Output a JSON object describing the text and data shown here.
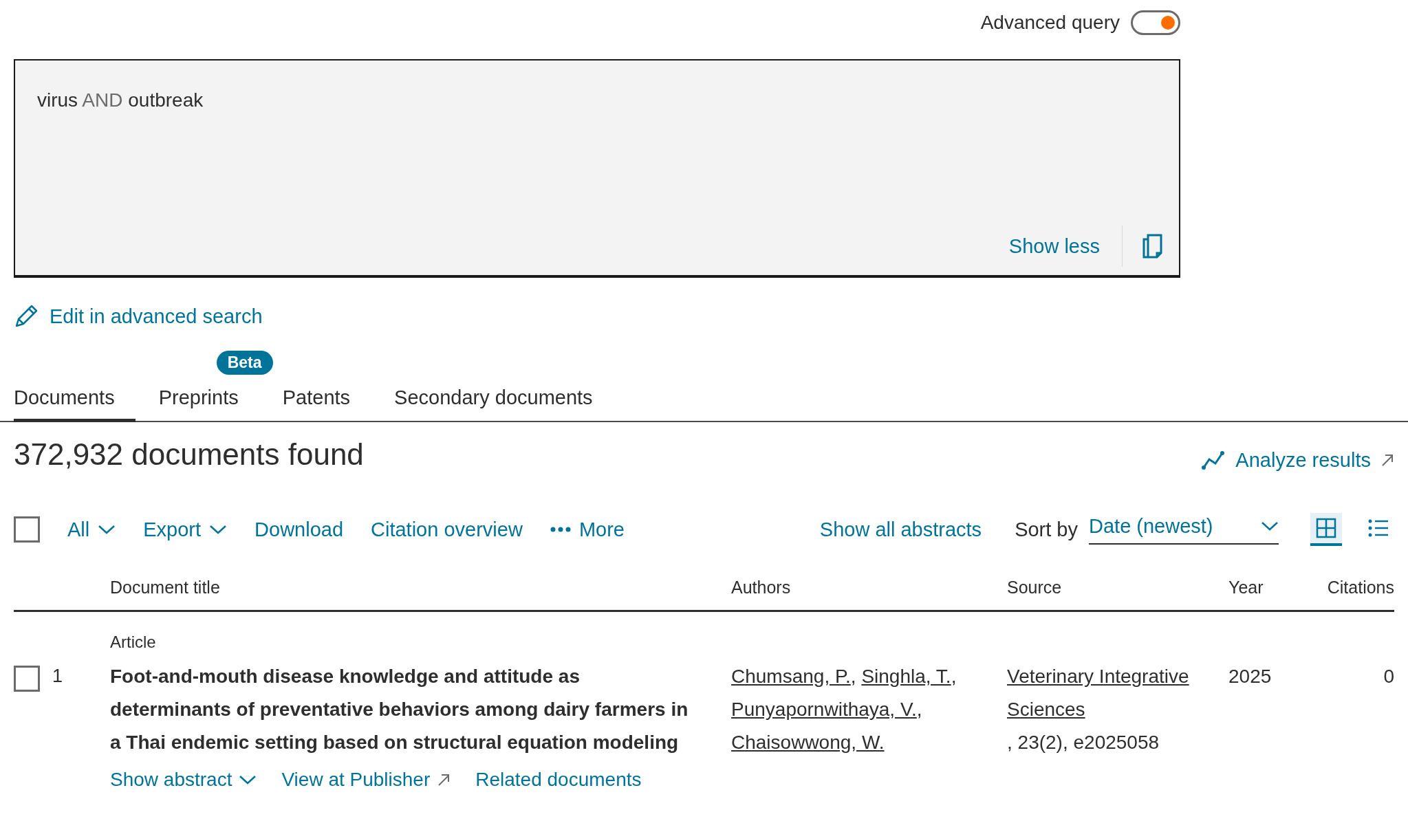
{
  "advanced_query": {
    "label": "Advanced query",
    "on": true
  },
  "query_box": {
    "parts": [
      {
        "kind": "term",
        "text": "virus"
      },
      {
        "kind": "operator",
        "text": "AND"
      },
      {
        "kind": "term",
        "text": "outbreak"
      }
    ],
    "toggle_label": "Show less"
  },
  "edit_link": "Edit in advanced search",
  "tabs": [
    {
      "label": "Documents",
      "selected": true
    },
    {
      "label": "Preprints",
      "selected": false,
      "badge": "Beta"
    },
    {
      "label": "Patents",
      "selected": false
    },
    {
      "label": "Secondary documents",
      "selected": false
    }
  ],
  "results_count": "372,932 documents found",
  "analyze_link": "Analyze results",
  "toolbar": {
    "select_all_checked": false,
    "actions": [
      {
        "label": "All",
        "kind": "dropdown"
      },
      {
        "label": "Export",
        "kind": "dropdown"
      },
      {
        "label": "Download",
        "kind": "link"
      },
      {
        "label": "Citation overview",
        "kind": "link"
      },
      {
        "label": "More",
        "kind": "more"
      }
    ],
    "show_all_abstracts": "Show all abstracts",
    "sort_label": "Sort by",
    "sort_value": "Date (newest)",
    "views": [
      {
        "kind": "grid",
        "selected": true
      },
      {
        "kind": "list",
        "selected": false
      }
    ]
  },
  "table": {
    "columns": [
      "Document title",
      "Authors",
      "Source",
      "Year",
      "Citations"
    ],
    "rows": [
      {
        "checked": false,
        "index": "1",
        "type": "Article",
        "title": "Foot-and-mouth disease knowledge and attitude as determinants of preventative behaviors among dairy farmers in a Thai endemic setting based on structural equation modeling",
        "author_separator": ",",
        "authors": [
          "Chumsang, P.",
          "Singhla, T.",
          "Punyapornwithaya, V.",
          "Chaisowwong, W."
        ],
        "source_name": "Veterinary Integrative Sciences",
        "source_details": ", 23(2), e2025058",
        "year": "2025",
        "citations": "0",
        "links": [
          {
            "label": "Show abstract",
            "kind": "dropdown"
          },
          {
            "label": "View at Publisher",
            "kind": "external"
          },
          {
            "label": "Related documents",
            "kind": "link"
          }
        ]
      }
    ]
  }
}
